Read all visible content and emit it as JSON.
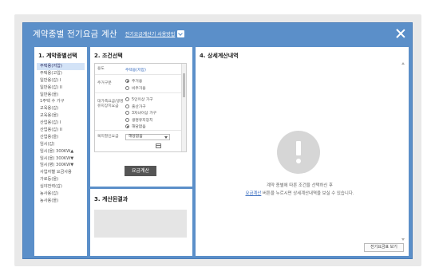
{
  "dialog": {
    "title": "계약종별 전기요금 계산",
    "help_link": "전기요금계산기 사용방법"
  },
  "panel1": {
    "title": "1. 계약종별선택",
    "items": [
      "주택용(저압)",
      "주택용(고압)",
      "일반용(갑) I",
      "일반용(갑) II",
      "일반용(을)",
      "1주택 수 가구",
      "교육용(갑)",
      "교육용(을)",
      "산업용(갑) I",
      "산업용(갑) II",
      "산업용(을)",
      "임시(갑)",
      "임시(을) 300KW▲",
      "임시(을) 300KW▼",
      "임시(병) 300KW▼",
      "사업자별 요금사용",
      "가로등(을)",
      "심야전력(갑)",
      "농사용(갑)",
      "농사용(을)"
    ],
    "selected_index": 0
  },
  "panel2": {
    "title": "2. 조건선택",
    "rows": {
      "type_label": "용도",
      "type_value": "주택용(저압)",
      "household_label": "주거구분",
      "household_options": [
        "주거용",
        "비주거용"
      ],
      "household_selected": 0,
      "family_label": "대가족요금/생명유지장치요금",
      "family_options": [
        "5인이상 가구",
        "출산가구",
        "3자녀이상 가구",
        "생명유지장치",
        "해당없음"
      ],
      "family_selected": 4,
      "welfare_label": "복지할인요금",
      "welfare_value": "해당없음"
    },
    "calc_button": "요금계산"
  },
  "panel3": {
    "title": "3. 계산된결과"
  },
  "panel4": {
    "title": "4. 상세계산내역",
    "message_line1": "계약 종별에 따른 조건을 선택하신 후",
    "message_link": "요금계산",
    "message_line2_rest": " 버튼을 누르시면 상세계산내역을 보실 수 있습니다.",
    "view_button": "전기요금표 보기"
  },
  "colors": {
    "frame": "#5b8fc9",
    "selected_item": "#d3e3f7",
    "calc_button": "#555555"
  }
}
